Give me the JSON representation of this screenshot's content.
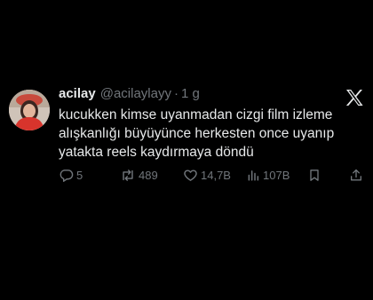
{
  "tweet": {
    "display_name": "acilay",
    "handle": "@acilaylayy",
    "separator": "·",
    "time": "1 g",
    "lines": [
      "kucukken kimse uyanmadan cizgi film izleme",
      "alışkanlığı büyüyünce herkesten once uyanıp",
      "yatakta reels kaydırmaya döndü"
    ]
  },
  "actions": {
    "replies": "5",
    "retweets": "489",
    "likes": "14,7B",
    "views": "107B"
  },
  "colors": {
    "background": "#000000",
    "text": "#e7e9ea",
    "muted": "#71767b"
  },
  "icons": [
    "x-logo-icon",
    "reply-icon",
    "retweet-icon",
    "like-icon",
    "views-icon",
    "bookmark-icon",
    "share-icon"
  ]
}
